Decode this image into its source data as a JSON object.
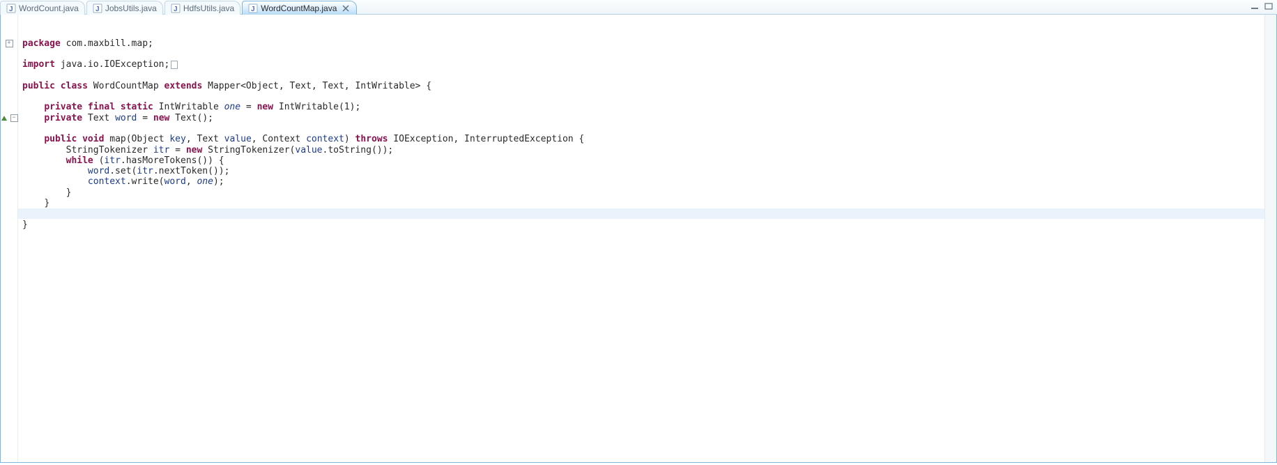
{
  "tabs": [
    {
      "label": "WordCount.java",
      "active": false
    },
    {
      "label": "JobsUtils.java",
      "active": false
    },
    {
      "label": "HdfsUtils.java",
      "active": false
    },
    {
      "label": "WordCountMap.java",
      "active": true
    }
  ],
  "code": {
    "package_kw": "package",
    "package_name": " com.maxbill.map;",
    "import_kw": "import",
    "import_name": " java.io.IOException;",
    "c_public": "public",
    "c_class": "class",
    "c_classname": " WordCountMap ",
    "c_extends": "extends",
    "c_sig": " Mapper<Object, Text, Text, IntWritable> {",
    "f1_mods": "private final static",
    "f1_type": " IntWritable ",
    "f1_name": "one",
    "f1_mid": " = ",
    "f1_new": "new",
    "f1_rest": " IntWritable(1);",
    "f2_mods": "private",
    "f2_type": " Text ",
    "f2_name": "word",
    "f2_mid": " = ",
    "f2_new": "new",
    "f2_rest": " Text();",
    "m_public": "public",
    "m_void": "void",
    "m_name": " map",
    "m_p1": "(Object ",
    "m_p1v": "key",
    "m_c1": ", Text ",
    "m_p2v": "value",
    "m_c2": ", Context ",
    "m_p3v": "context",
    "m_close": ") ",
    "m_throws": "throws",
    "m_ex": " IOException, InterruptedException {",
    "l1a": "StringTokenizer ",
    "l1b": "itr",
    "l1c": " = ",
    "l1new": "new",
    "l1d": " StringTokenizer(",
    "l1e": "value",
    "l1f": ".toString());",
    "l2a": "while",
    "l2b": " (",
    "l2c": "itr",
    "l2d": ".hasMoreTokens()) {",
    "l3a": "word",
    "l3b": ".set(",
    "l3c": "itr",
    "l3d": ".nextToken());",
    "l4a": "context",
    "l4b": ".write(",
    "l4c": "word",
    "l4d": ", ",
    "l4e": "one",
    "l4f": ");",
    "l5": "}",
    "l6": "}",
    "l7": "}"
  }
}
